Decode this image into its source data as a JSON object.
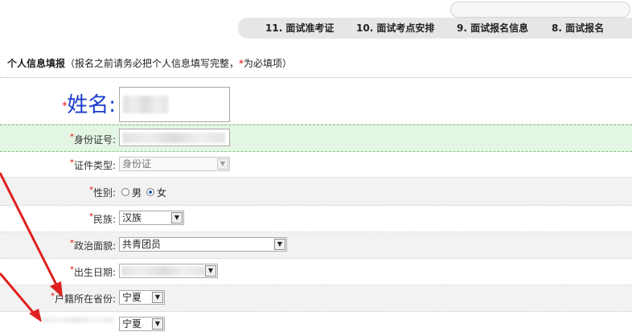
{
  "tabs": [
    {
      "label": "11. 面试准考证"
    },
    {
      "label": "10. 面试考点安排"
    },
    {
      "label": "9. 面试报名信息"
    },
    {
      "label": "8. 面试报名"
    }
  ],
  "section": {
    "title": "个人信息填报",
    "note_open": "（报名之前请务必把个人信息填写完整，",
    "note_req": "*",
    "note_close": "为必填项）"
  },
  "form": {
    "required_mark": "*",
    "name_label": "姓名:",
    "id_number_label": "身份证号:",
    "id_type_label": "证件类型:",
    "id_type_value": "身份证",
    "gender_label": "性别:",
    "gender_options": [
      "男",
      "女"
    ],
    "gender_selected": "女",
    "ethnicity_label": "民族:",
    "ethnicity_value": "汉族",
    "political_label": "政治面貌:",
    "political_value": "共青团员",
    "birthdate_label": "出生日期:",
    "household_province_label": "户籍所在省份:",
    "household_province_value": "宁夏",
    "next_row_value": "宁夏"
  },
  "colors": {
    "required": "#e60000",
    "name_label": "#1a3ccf",
    "highlight_row": "#e3f6e3",
    "annotation_arrow": "#e02020"
  }
}
